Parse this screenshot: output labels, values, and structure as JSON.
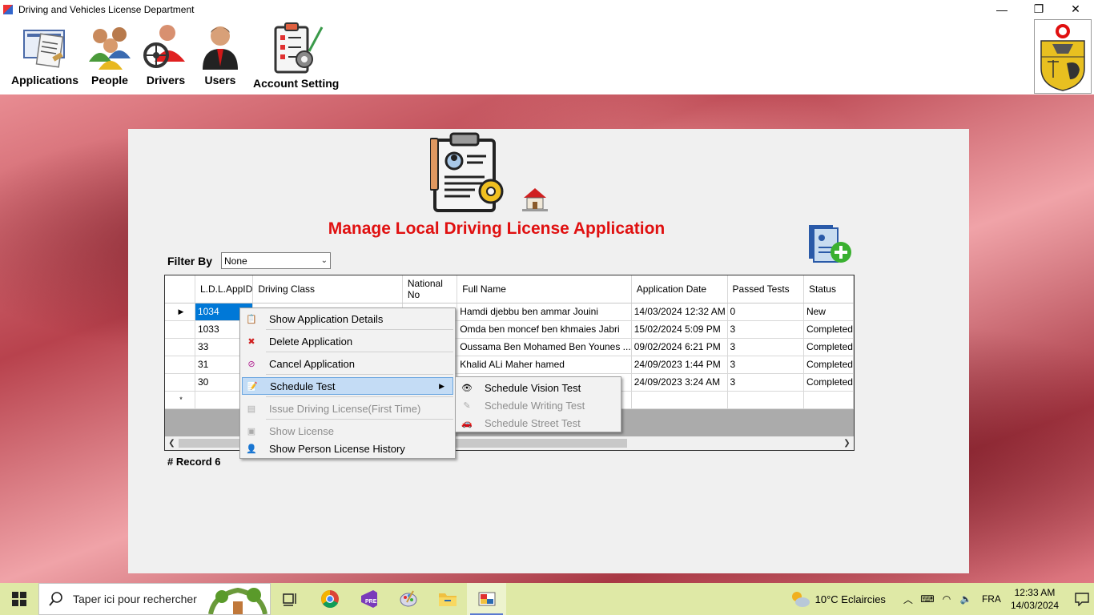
{
  "window": {
    "title": "Driving and Vehicles License Department",
    "controls": {
      "minimize": "—",
      "restore": "❐",
      "close": "✕"
    }
  },
  "menu": {
    "items": [
      {
        "label": "Applications",
        "icon": "applications-icon"
      },
      {
        "label": "People",
        "icon": "people-icon"
      },
      {
        "label": "Drivers",
        "icon": "drivers-icon"
      },
      {
        "label": "Users",
        "icon": "users-icon"
      },
      {
        "label": "Account Setting",
        "icon": "account-setting-icon"
      }
    ]
  },
  "page": {
    "title": "Manage Local Driving License Application",
    "filter_label": "Filter By",
    "filter_value": "None",
    "record_label": "# Record 6"
  },
  "grid": {
    "columns": [
      "L.D.L.AppID",
      "Driving Class",
      "National No",
      "Full Name",
      "Application Date",
      "Passed Tests",
      "Status"
    ],
    "rows": [
      {
        "id": "1034",
        "class": "",
        "national": "",
        "name": "Hamdi djebbu ben ammar Jouini",
        "date": "14/03/2024 12:32 AM",
        "passed": "0",
        "status": "New"
      },
      {
        "id": "1033",
        "class": "",
        "national": "",
        "name": "Omda ben moncef ben khmaies Jabri",
        "date": "15/02/2024 5:09 PM",
        "passed": "3",
        "status": "Completed"
      },
      {
        "id": "33",
        "class": "",
        "national": "",
        "name": "Oussama Ben Mohamed Ben Younes ...",
        "date": "09/02/2024 6:21 PM",
        "passed": "3",
        "status": "Completed"
      },
      {
        "id": "31",
        "class": "",
        "national": "",
        "name": "Khalid ALi Maher hamed",
        "date": "24/09/2023 1:44 PM",
        "passed": "3",
        "status": "Completed"
      },
      {
        "id": "30",
        "class": "",
        "national": "",
        "name": "",
        "date": "24/09/2023 3:24 AM",
        "passed": "3",
        "status": "Completed"
      }
    ],
    "new_row_marker": "*",
    "current_row_marker": "▶"
  },
  "context_menu": {
    "items": [
      {
        "label": "Show Application Details",
        "enabled": true
      },
      {
        "label": "Delete Application",
        "enabled": true
      },
      {
        "label": "Cancel Application",
        "enabled": true
      },
      {
        "label": "Schedule Test",
        "enabled": true,
        "highlighted": true
      },
      {
        "label": "Issue Driving License(First Time)",
        "enabled": false
      },
      {
        "label": "Show License",
        "enabled": false
      },
      {
        "label": "Show Person License History",
        "enabled": true
      }
    ],
    "submenu": [
      {
        "label": "Schedule Vision Test",
        "enabled": true
      },
      {
        "label": "Schedule Writing Test",
        "enabled": false
      },
      {
        "label": "Schedule Street Test",
        "enabled": false
      }
    ]
  },
  "taskbar": {
    "search_placeholder": "Taper ici pour rechercher",
    "weather": "10°C  Eclaircies",
    "language": "FRA",
    "time": "12:33 AM",
    "date": "14/03/2024"
  },
  "colors": {
    "title_red": "#e01010",
    "selection_blue": "#0078d7",
    "menu_highlight": "#c4dcf5",
    "taskbar": "#dfe9a6"
  }
}
